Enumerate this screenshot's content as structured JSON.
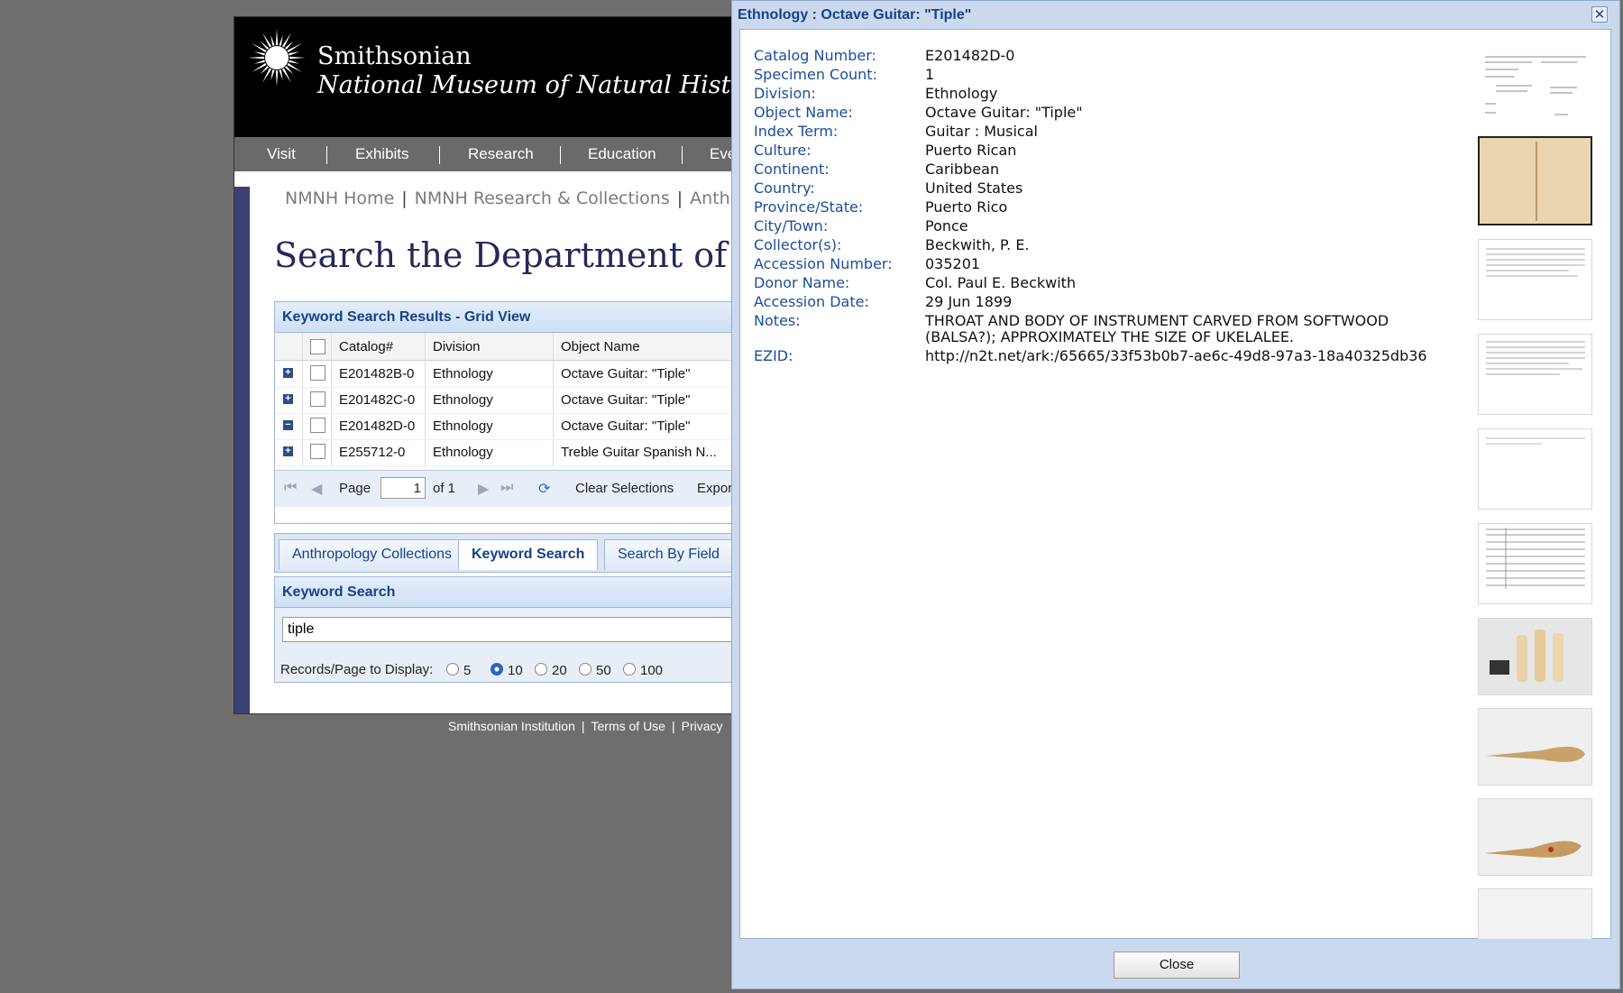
{
  "site": {
    "logo_line1": "Smithsonian",
    "logo_line2": "National Museum of Natural History",
    "nav": [
      "Visit",
      "Exhibits",
      "Research",
      "Education",
      "Eve"
    ],
    "breadcrumb": [
      "NMNH Home",
      "NMNH Research & Collections",
      "Anthro"
    ],
    "page_title": "Search the Department of Anth"
  },
  "results": {
    "panel_title": "Keyword Search Results - Grid View",
    "columns": [
      "Catalog#",
      "Division",
      "Object Name"
    ],
    "rows": [
      {
        "expander": "+",
        "catalog": "E201482B-0",
        "division": "Ethnology",
        "object": "Octave Guitar: \"Tiple\""
      },
      {
        "expander": "+",
        "catalog": "E201482C-0",
        "division": "Ethnology",
        "object": "Octave Guitar: \"Tiple\""
      },
      {
        "expander": "−",
        "catalog": "E201482D-0",
        "division": "Ethnology",
        "object": "Octave Guitar: \"Tiple\""
      },
      {
        "expander": "+",
        "catalog": "E255712-0",
        "division": "Ethnology",
        "object": "Treble Guitar Spanish N..."
      }
    ],
    "pager": {
      "page_label": "Page",
      "page_value": "1",
      "of_label": "of 1",
      "clear": "Clear Selections",
      "export": "Expor"
    }
  },
  "tabs": [
    "Anthropology Collections",
    "Keyword Search",
    "Search By Field"
  ],
  "keyword": {
    "panel_title": "Keyword Search",
    "value": "tiple",
    "records_label": "Records/Page to Display:",
    "options": [
      "5",
      "10",
      "20",
      "50",
      "100"
    ],
    "selected": "10"
  },
  "footer": [
    "Smithsonian Institution",
    "Terms of Use",
    "Privacy"
  ],
  "modal": {
    "title": "Ethnology : Octave Guitar: \"Tiple\"",
    "close_label": "Close",
    "fields": [
      {
        "label": "Catalog Number:",
        "value": "E201482D-0"
      },
      {
        "label": "Specimen Count:",
        "value": "1"
      },
      {
        "label": "Division:",
        "value": "Ethnology"
      },
      {
        "label": "Object Name:",
        "value": "Octave Guitar: \"Tiple\""
      },
      {
        "label": "Index Term:",
        "value": "Guitar : Musical"
      },
      {
        "label": "Culture:",
        "value": "Puerto Rican"
      },
      {
        "label": "Continent:",
        "value": "Caribbean"
      },
      {
        "label": "Country:",
        "value": "United States"
      },
      {
        "label": "Province/State:",
        "value": "Puerto Rico"
      },
      {
        "label": "City/Town:",
        "value": "Ponce"
      },
      {
        "label": "Collector(s):",
        "value": "Beckwith, P. E."
      },
      {
        "label": "Accession Number:",
        "value": "035201"
      },
      {
        "label": "Donor Name:",
        "value": "Col. Paul E. Beckwith"
      },
      {
        "label": "Accession Date:",
        "value": "29 Jun 1899"
      },
      {
        "label": "Notes:",
        "value": "THROAT AND BODY OF INSTRUMENT CARVED FROM SOFTWOOD",
        "value2": "(BALSA?); APPROXIMATELY THE SIZE OF UKELALEE."
      },
      {
        "label": "EZID:",
        "value": "http://n2t.net/ark:/65665/33f53b0b7-ae6c-49d8-97a3-18a40325db36"
      }
    ]
  }
}
